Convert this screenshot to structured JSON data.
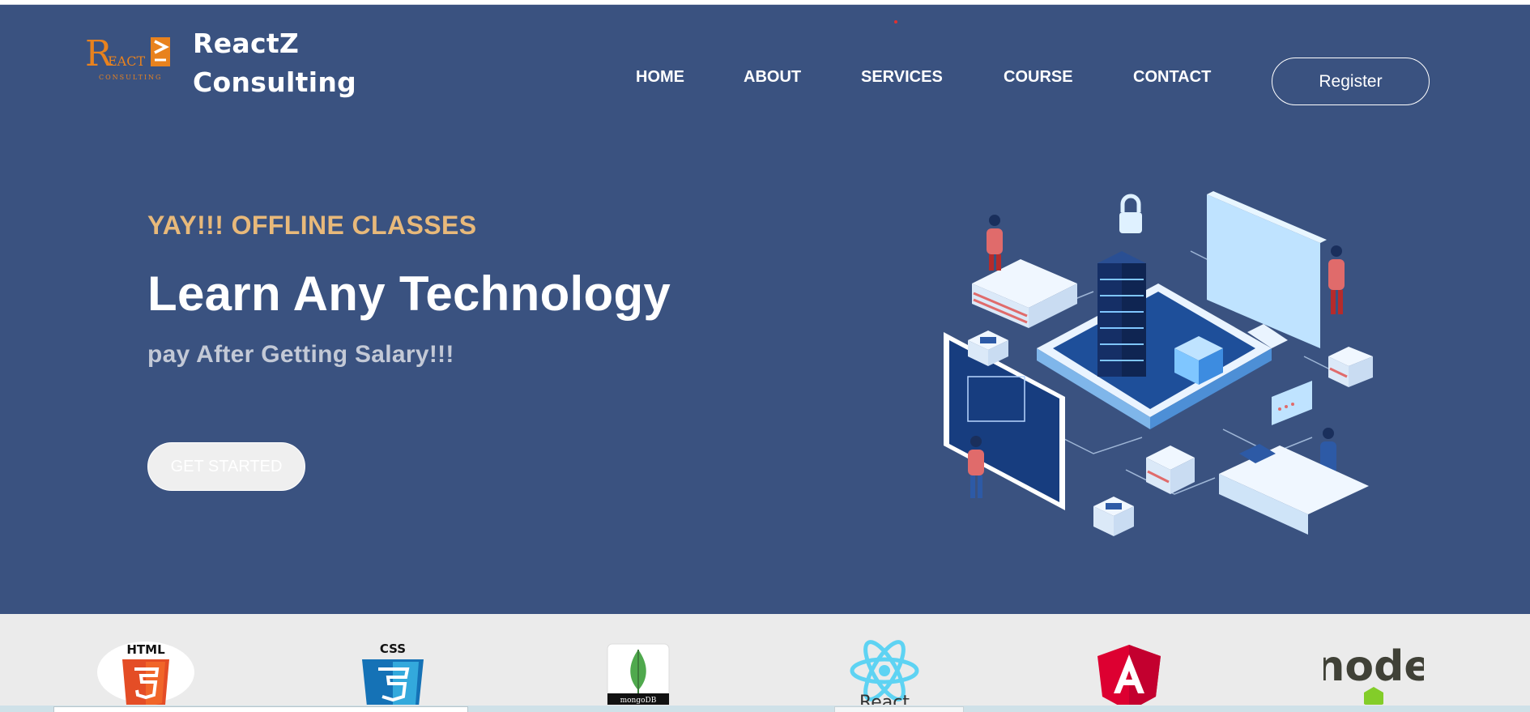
{
  "brand": {
    "name_line1": "ReactZ",
    "name_line2": "Consulting",
    "logo_letters": "REACTZ",
    "logo_subtitle": "CONSULTING"
  },
  "nav": {
    "items": [
      {
        "label": "HOME"
      },
      {
        "label": "ABOUT"
      },
      {
        "label": "SERVICES"
      },
      {
        "label": "COURSE"
      },
      {
        "label": "CONTACT"
      }
    ],
    "register_label": "Register"
  },
  "hero": {
    "kicker": "YAY!!! OFFLINE CLASSES",
    "headline": "Learn Any Technology",
    "subline": "pay After Getting Salary!!!",
    "cta_label": "GET STARTED"
  },
  "technologies": [
    {
      "name": "HTML",
      "icon": "html5-icon"
    },
    {
      "name": "CSS",
      "icon": "css3-icon"
    },
    {
      "name": "mongoDB",
      "icon": "mongodb-icon"
    },
    {
      "name": "React",
      "icon": "react-icon"
    },
    {
      "name": "Angular",
      "icon": "angular-icon"
    },
    {
      "name": "node",
      "icon": "nodejs-icon"
    }
  ],
  "colors": {
    "hero_bg": "#3a5280",
    "kicker": "#e8b97a",
    "subline": "#c3c9d6",
    "logo_orange": "#e8821e"
  }
}
